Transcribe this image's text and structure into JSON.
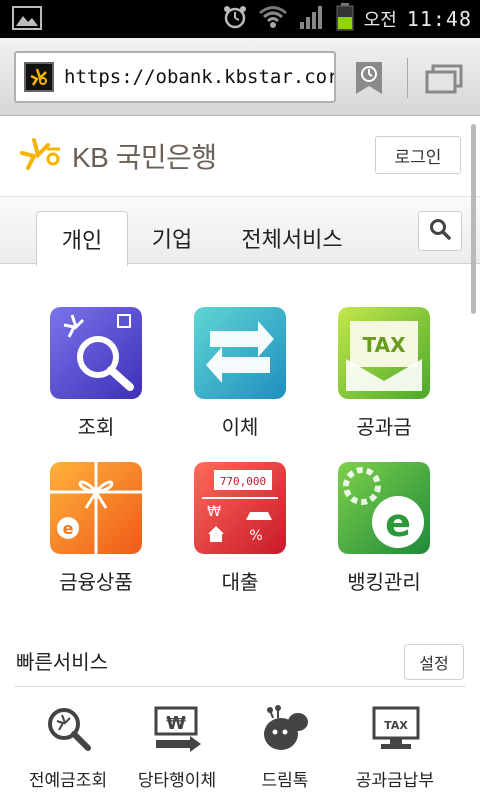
{
  "status_bar": {
    "ampm": "오전",
    "time": "11:48",
    "battery_color": "#8fd400"
  },
  "browser": {
    "url": "https://obank.kbstar.cor"
  },
  "header": {
    "logo_text": "KB 국민은행",
    "login_label": "로그인",
    "accent_color": "#f5b400"
  },
  "tabs": [
    {
      "label": "개인",
      "active": true
    },
    {
      "label": "기업",
      "active": false
    },
    {
      "label": "전체서비스",
      "active": false
    }
  ],
  "menu": [
    {
      "label": "조회",
      "icon": "magnifier-icon",
      "color": "#5b4fd6"
    },
    {
      "label": "이체",
      "icon": "transfer-arrows-icon",
      "color": "#2bb0c8"
    },
    {
      "label": "공과금",
      "icon": "tax-envelope-icon",
      "color": "#8ccc2a"
    },
    {
      "label": "금융상품",
      "icon": "gift-ribbon-icon",
      "color": "#f08a1c"
    },
    {
      "label": "대출",
      "icon": "loan-house-icon",
      "color": "#e0343a"
    },
    {
      "label": "뱅킹관리",
      "icon": "gear-e-icon",
      "color": "#3aa64a"
    }
  ],
  "loan_amount": "770,000",
  "quick_services": {
    "title": "빠른서비스",
    "setting_label": "설정",
    "items": [
      {
        "label": "전예금조회",
        "icon": "account-search-icon"
      },
      {
        "label": "당타행이체",
        "icon": "won-transfer-icon"
      },
      {
        "label": "드림톡",
        "icon": "dreamtalk-character-icon"
      },
      {
        "label": "공과금납부",
        "icon": "tax-monitor-icon"
      }
    ]
  }
}
